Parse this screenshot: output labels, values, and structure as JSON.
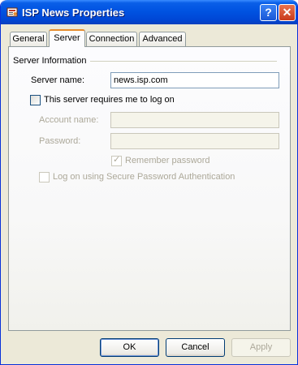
{
  "window": {
    "title": "ISP News Properties",
    "icon": "news-properties-icon",
    "help_glyph": "?",
    "close_glyph": "✕"
  },
  "tabs": [
    {
      "label": "General",
      "active": false
    },
    {
      "label": "Server",
      "active": true
    },
    {
      "label": "Connection",
      "active": false
    },
    {
      "label": "Advanced",
      "active": false
    }
  ],
  "server_info": {
    "group_title": "Server Information",
    "server_name_label": "Server name:",
    "server_name_value": "news.isp.com",
    "require_logon_label": "This server requires me to log on",
    "require_logon_checked": false,
    "account_name_label": "Account name:",
    "account_name_value": "",
    "password_label": "Password:",
    "password_value": "",
    "remember_password_label": "Remember password",
    "remember_password_checked": true,
    "spa_label": "Log on using Secure Password Authentication",
    "spa_checked": false
  },
  "buttons": {
    "ok": "OK",
    "cancel": "Cancel",
    "apply": "Apply"
  },
  "colors": {
    "titlebar": "#0053e1",
    "tab_highlight": "#e68b2c",
    "disabled_text": "#aca899"
  }
}
